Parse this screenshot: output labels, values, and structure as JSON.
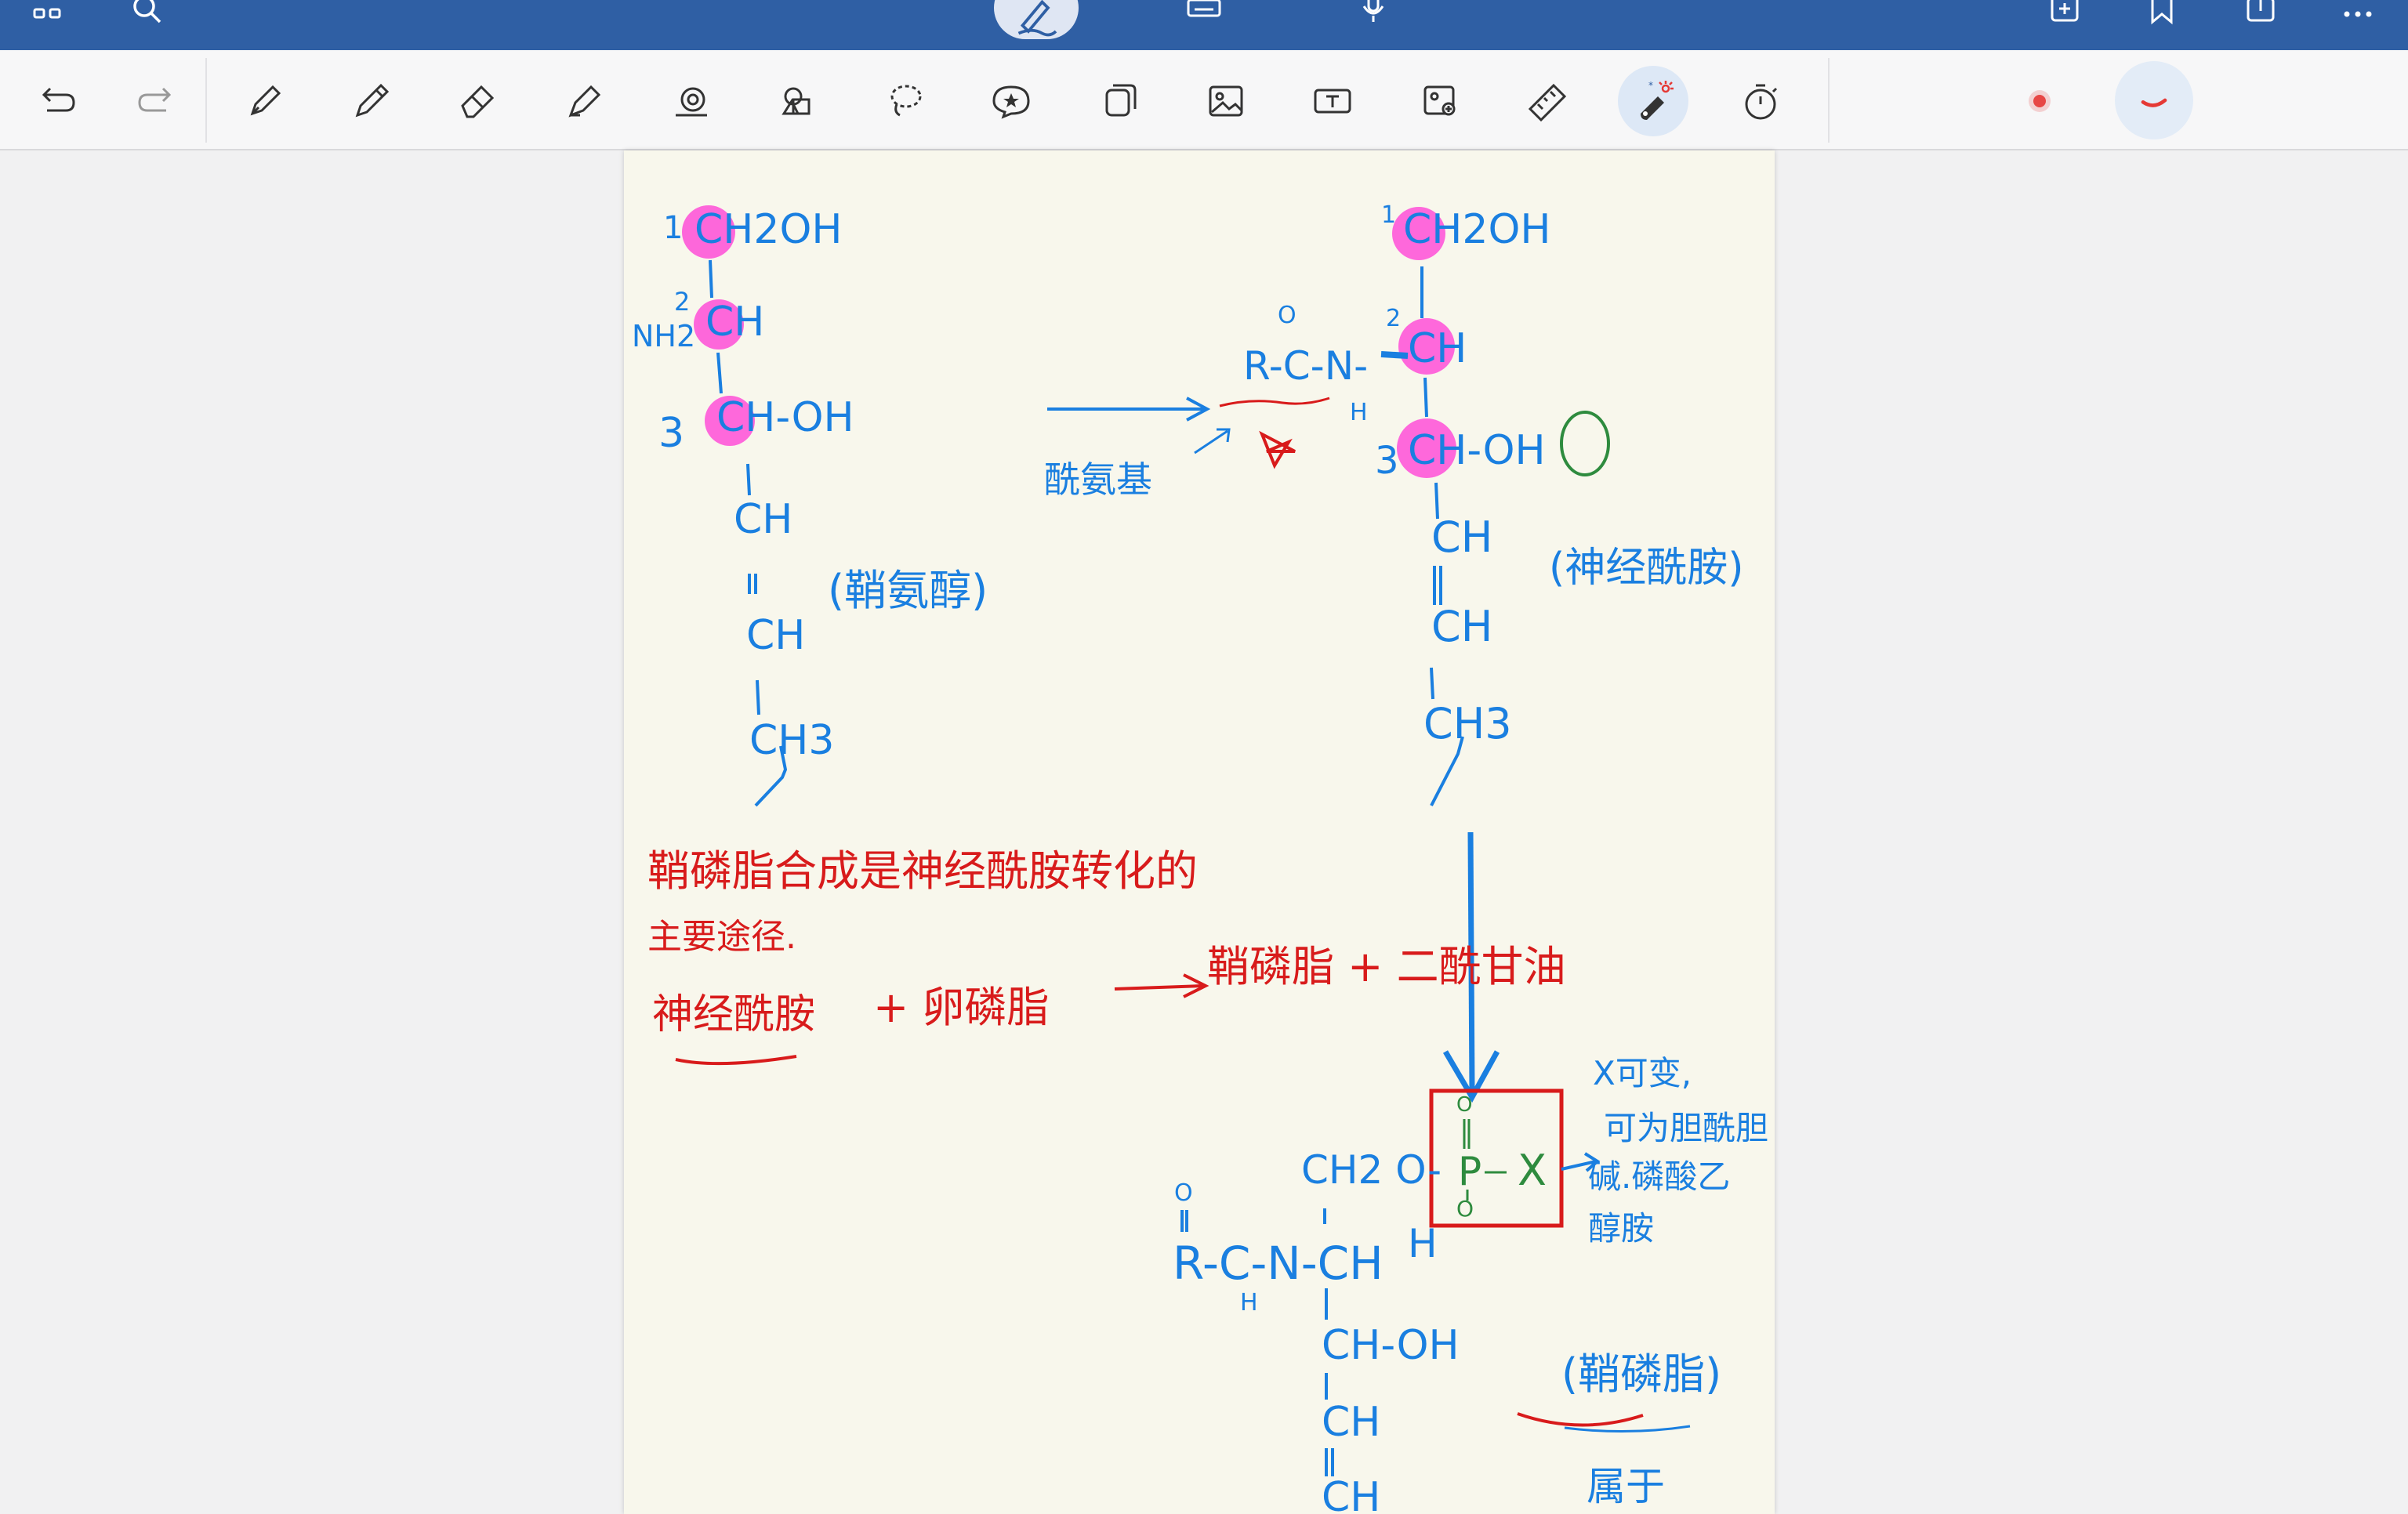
{
  "app": {
    "accent_color": "#2f5fa4",
    "toolbar_bg": "#f7f7f8"
  },
  "top_bar": {
    "icons": [
      "grid-icon",
      "search-icon",
      "pen-mode-icon",
      "keyboard-icon",
      "microphone-icon",
      "add-page-icon",
      "bookmark-icon",
      "share-icon",
      "more-icon"
    ]
  },
  "toolbar": {
    "tools": [
      "undo",
      "redo",
      "fountain-pen",
      "pencil",
      "eraser",
      "highlighter",
      "shape",
      "lasso-shapes",
      "lasso",
      "sticker",
      "copy-page",
      "image",
      "text-box",
      "image-search",
      "ruler",
      "laser-pointer",
      "timer"
    ],
    "active_tool": "laser-pointer",
    "laser_color": "#e53935"
  },
  "page": {
    "background": "#f8f7ec",
    "ink": {
      "blue": "#1a7fe0",
      "red": "#d81b1b",
      "green": "#2e8b3e",
      "magenta": "#ff4fd8"
    },
    "notes": {
      "sphingosine": {
        "c1": "CH2OH",
        "c2": "CH",
        "nh2": "NH2",
        "c3": "CH-OH",
        "chain1": "CH",
        "chain2": "CH",
        "chain3": "CH3",
        "n1": "1",
        "n2": "2",
        "n3": "3",
        "name": "(鞘氨醇)"
      },
      "arrow_label": "酰氨基",
      "ceramide": {
        "c1": "CH2OH",
        "acyl": "R-C-N-",
        "o": "O",
        "h": "H",
        "c2": "CH",
        "c3": "CH-OH",
        "chain1": "CH",
        "chain2": "CH",
        "chain3": "CH3",
        "n1": "1",
        "n2": "2",
        "n3": "3",
        "name": "(神经酰胺)"
      },
      "red_line1": "鞘磷脂合成是神经酰胺转化的",
      "red_line2": "主要途径.",
      "red_eq_left": "神经酰胺",
      "red_eq_plus": "+ 卵磷脂",
      "red_eq_right": "鞘磷脂 + 二酰甘油",
      "sphingomyelin": {
        "ch2o": "CH2 O-",
        "p": "P",
        "x": "X",
        "o_top": "O",
        "o_bot": "O",
        "acyl": "R-C-N-CH",
        "o": "O",
        "h": "H",
        "nh": "H",
        "c3": "CH-OH",
        "chain1": "CH",
        "chain2": "CH",
        "name": "(鞘磷脂)",
        "below": "属于"
      },
      "x_note_1": "X可变,",
      "x_note_2": "可为胆酰胆",
      "x_note_3": "碱.磷酸乙",
      "x_note_4": "醇胺"
    }
  }
}
